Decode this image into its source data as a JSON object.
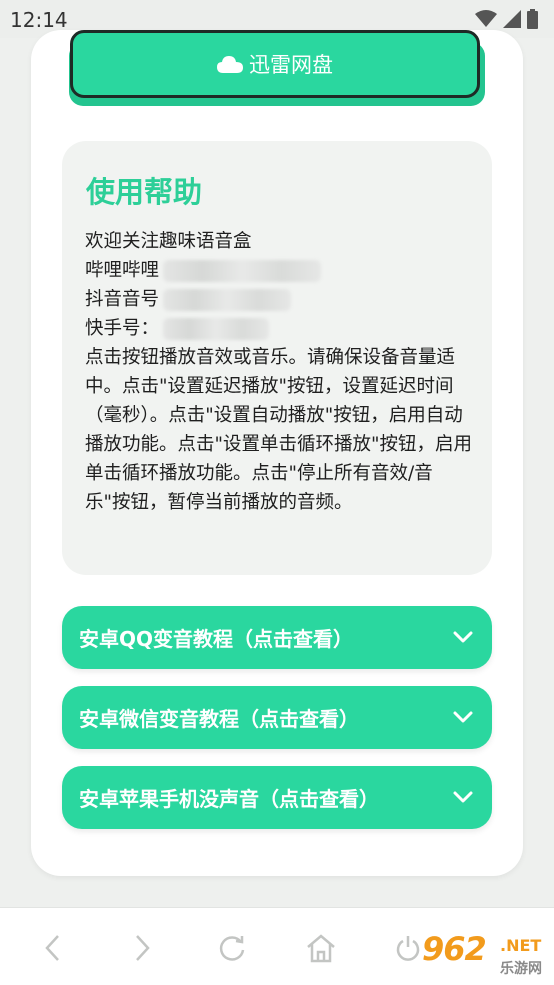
{
  "status_bar": {
    "time": "12:14"
  },
  "pan_button": {
    "label": "迅雷网盘"
  },
  "help": {
    "title": "使用帮助",
    "line_welcome": "欢迎关注趣味语音盒",
    "line_bilibili": "哔哩哔哩",
    "line_douyin": "抖音音号",
    "line_kuaishou": "快手号：",
    "paragraph": "点击按钮播放音效或音乐。请确保设备音量适中。点击\"设置延迟播放\"按钮，设置延迟时间（毫秒）。点击\"设置自动播放\"按钮，启用自动播放功能。点击\"设置单击循环播放\"按钮，启用单击循环播放功能。点击\"停止所有音效/音乐\"按钮，暂停当前播放的音频。"
  },
  "accordions": [
    {
      "label": "安卓QQ变音教程（点击查看）"
    },
    {
      "label": "安卓微信变音教程（点击查看）"
    },
    {
      "label": "安卓苹果手机没声音（点击查看）"
    }
  ],
  "watermark": {
    "number": "962",
    "net": ".NET",
    "sub": "乐游网"
  },
  "colors": {
    "accent": "#2ad79f",
    "title": "#2dcf98",
    "background": "#eef0ee"
  },
  "icons": [
    "wifi-icon",
    "signal-icon",
    "battery-icon",
    "cloud-icon",
    "chevron-down-icon",
    "back-icon",
    "forward-icon",
    "refresh-icon",
    "home-icon",
    "power-icon"
  ]
}
